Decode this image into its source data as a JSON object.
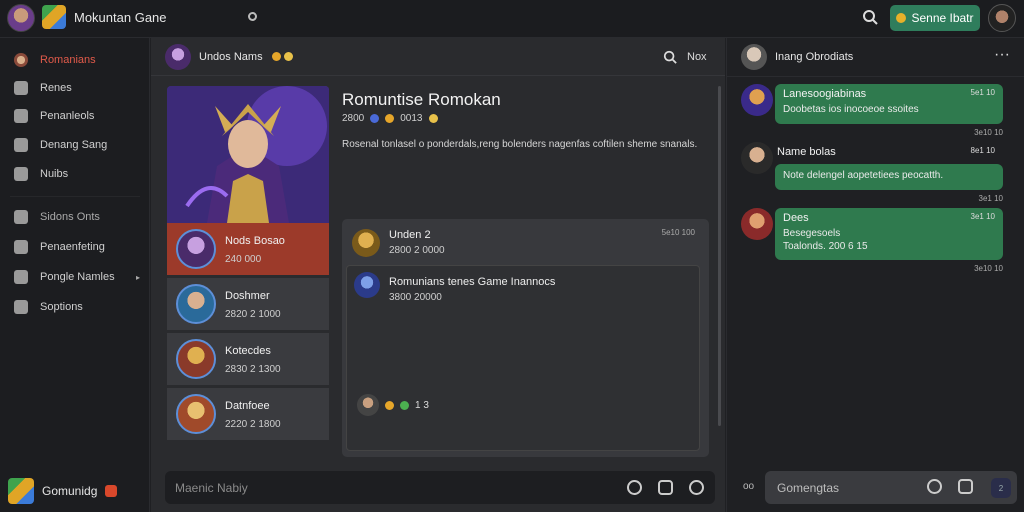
{
  "topbar": {
    "title": "Mokuntan Gane",
    "action_label": "Senne Ibatr"
  },
  "sidebar": {
    "items": [
      {
        "label": "Romanians",
        "icon": "user-avatar-icon"
      },
      {
        "label": "Renes",
        "icon": "home-icon"
      },
      {
        "label": "Penanleols",
        "icon": "panel-icon"
      },
      {
        "label": "Denang Sang",
        "icon": "x-icon"
      },
      {
        "label": "Nuibs",
        "icon": "puzzle-icon"
      },
      {
        "label": "Sidons Onts",
        "icon": "star-icon"
      },
      {
        "label": "Penaenfeting",
        "icon": "target-icon"
      },
      {
        "label": "Pongle Namles",
        "icon": "people-icon"
      },
      {
        "label": "Soptions",
        "icon": "person-icon"
      }
    ],
    "community_label": "Gomunidg"
  },
  "channel": {
    "title": "Undos Nams",
    "more_label": "Nox"
  },
  "games": [
    {
      "name": "Nods Bosao",
      "meta": "240 000"
    },
    {
      "name": "Doshmer",
      "meta": "2820 2 1000"
    },
    {
      "name": "Kotecdes",
      "meta": "2830 2 1300"
    },
    {
      "name": "Datnfoee",
      "meta": "2220 2 1800"
    }
  ],
  "detail": {
    "title": "Romuntise Romokan",
    "meta_a": "2800",
    "meta_b": "0013",
    "description": "Rosenal tonlasel o ponderdals,reng bolenders nagenfas coftilen sheme snanals."
  },
  "thread": {
    "author": "Unden 2",
    "meta": "2800 2 0000",
    "time": "5e10 100",
    "reply": {
      "author": "Romunians tenes Game Inannocs",
      "meta": "3800 20000",
      "reactions": "1 3"
    }
  },
  "composer": {
    "placeholder": "Maenic Nabiy"
  },
  "right_panel": {
    "title": "Inang Obrodiats",
    "messages": [
      {
        "name": "Lanesoogiabinas",
        "time": "5e1 10",
        "text": "Doobetas ios inocoeoe ssoites",
        "stamp": "3e10 10"
      },
      {
        "name": "Name bolas",
        "time": "8e1 10",
        "text": "Note delengel aopetetiees peocatth.",
        "stamp": "3e1 10"
      },
      {
        "name": "Dees",
        "time": "3e1 10",
        "text": "Besegesoels",
        "text2": "Toalonds. 200 6 15",
        "stamp": "3e10 10"
      }
    ],
    "composer_placeholder": "Gomengtas",
    "send_label": "2"
  },
  "colors": {
    "accent_green": "#2f7d5c",
    "selected_red": "#9c3a2a",
    "bubble_green": "#2f7a4e"
  }
}
